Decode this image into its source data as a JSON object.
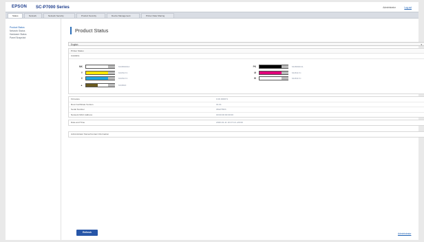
{
  "header": {
    "brand": "EPSON",
    "product": "SC-P7000 Series",
    "user_label": "Administrator",
    "logout_label": "Log out"
  },
  "tabs": [
    {
      "label": "Status",
      "active": true
    },
    {
      "label": "Network"
    },
    {
      "label": "Network Security"
    },
    {
      "label": "Product Security"
    },
    {
      "label": "Device Management"
    },
    {
      "label": "Printer Data Sharing"
    }
  ],
  "sidebar": {
    "items": [
      {
        "label": "Product Status",
        "active": true
      },
      {
        "label": "Network Status"
      },
      {
        "label": "Hardware Status"
      },
      {
        "label": "Panel Snapshot"
      }
    ]
  },
  "main": {
    "title": "Product Status",
    "language": "English",
    "printer_status": {
      "heading": "Printer Status",
      "status": "Available"
    },
    "inks": [
      {
        "label": "MK",
        "color": "#ffffff",
        "level": 0.6,
        "code": "MC8800610"
      },
      {
        "label": "Y",
        "color": "#ffe600",
        "level": 0.78,
        "code": "MC8317C"
      },
      {
        "label": "C",
        "color": "#1ea6e0",
        "level": 0.82,
        "code": "MC8317C"
      },
      {
        "label": "▲",
        "color": "#6a5a1f",
        "level": 0.42,
        "code": "MC8820"
      },
      {
        "label": "PK",
        "color": "#000000",
        "level": 0.95,
        "code": "MC8800F31"
      },
      {
        "label": "M",
        "color": "#e0007a",
        "level": 0.88,
        "code": "MC8317C"
      },
      {
        "label": "W",
        "color": "#ffffff",
        "level": 0.68,
        "code": "MC8317C"
      }
    ],
    "info_rows": [
      {
        "label": "Firmware",
        "value": "0.00.000071"
      },
      {
        "label": "Root Certificate Version",
        "value": "01.01"
      },
      {
        "label": "Serial Number",
        "value": "0812TBF3"
      },
      {
        "label": "Network MAC Address",
        "value": "00:00:00:00:00:00"
      }
    ],
    "date_row": {
      "label": "Date and Time",
      "value": "2020-01-11 10:47:19 +00:00"
    },
    "admin_row": {
      "label": "Administrator Name/Contact Information"
    },
    "refresh_label": "Refresh",
    "admin_link_label": "Administrator"
  }
}
